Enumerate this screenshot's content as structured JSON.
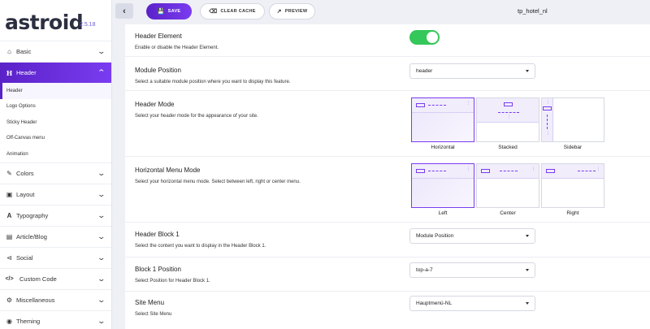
{
  "app": {
    "logo": "astroid",
    "version": "2.5.18"
  },
  "topbar": {
    "save": "SAVE",
    "clear_cache": "CLEAR CACHE",
    "preview": "PREVIEW",
    "page_name": "tp_hotel_nl"
  },
  "sidebar": {
    "items": [
      {
        "label": "Basic",
        "icon": "home-icon"
      },
      {
        "label": "Header",
        "icon": "header-icon"
      },
      {
        "label": "Colors",
        "icon": "brush-icon"
      },
      {
        "label": "Layout",
        "icon": "layout-icon"
      },
      {
        "label": "Typography",
        "icon": "typography-icon"
      },
      {
        "label": "Article/Blog",
        "icon": "article-icon"
      },
      {
        "label": "Social",
        "icon": "share-icon"
      },
      {
        "label": "Custom Code",
        "icon": "code-icon"
      },
      {
        "label": "Miscellaneous",
        "icon": "cogs-icon"
      },
      {
        "label": "Theming",
        "icon": "palette-icon"
      }
    ],
    "sub_items": [
      "Header",
      "Logo Options",
      "Sticky Header",
      "Off-Canvas menu",
      "Animation"
    ]
  },
  "settings": {
    "header_element": {
      "title": "Header Element",
      "desc": "Enable or disable the Header Element."
    },
    "module_position": {
      "title": "Module Position",
      "desc": "Select a suitable module position where you want to display this feature.",
      "value": "header"
    },
    "header_mode": {
      "title": "Header Mode",
      "desc": "Select your header mode for the appearance of your site.",
      "options": [
        "Horizontal",
        "Stacked",
        "Sidebar"
      ]
    },
    "horizontal_menu_mode": {
      "title": "Horizontal Menu Mode",
      "desc": "Select your horizontal menu mode. Select between left, right or center menu.",
      "options": [
        "Left",
        "Center",
        "Right"
      ]
    },
    "header_block_1": {
      "title": "Header Block 1",
      "desc": "Select the content you want to display in the Header Block 1.",
      "value": "Module Position"
    },
    "block_1_position": {
      "title": "Block 1 Position",
      "desc": "Select Position for Header Block 1.",
      "value": "top-a-7"
    },
    "site_menu": {
      "title": "Site Menu",
      "desc": "Select Site Menu",
      "value": "Hauptmenü-NL"
    }
  },
  "colors": {
    "accent": "#6b2ee0",
    "toggle_on": "#34c759"
  }
}
